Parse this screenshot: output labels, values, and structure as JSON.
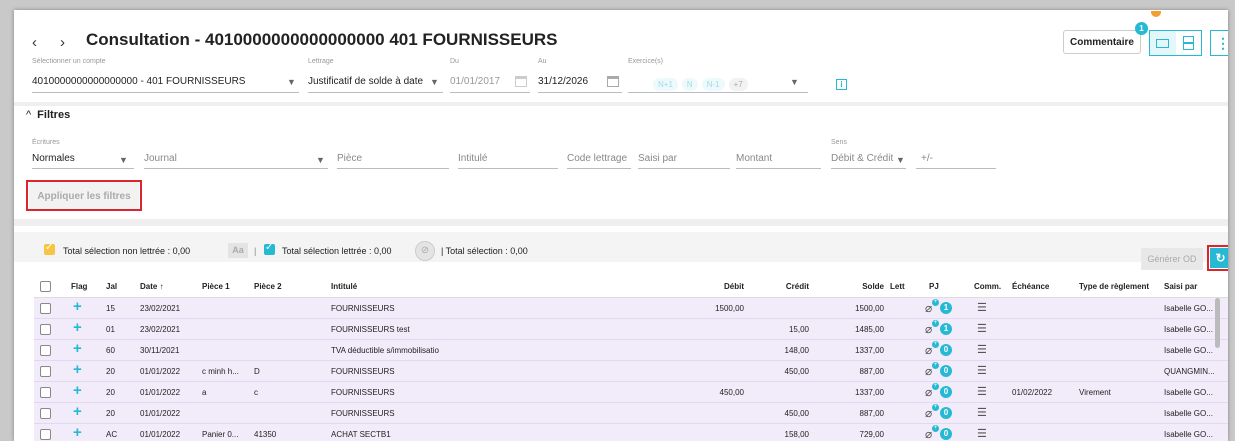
{
  "header": {
    "title": "Consultation - 4010000000000000000 401 FOURNISSEURS",
    "account_label": "Sélectionner un compte",
    "account_value": "4010000000000000000 - 401 FOURNISSEURS",
    "lettrage_label": "Lettrage",
    "lettrage_value": "Justificatif de solde à date",
    "du_label": "Du",
    "du_value": "01/01/2017",
    "au_label": "Au",
    "au_value": "31/12/2026",
    "exercice_label": "Exercice(s)",
    "exercice_chips": [
      "N+1",
      "N",
      "N-1",
      "+7"
    ],
    "comment_label": "Commentaire",
    "comment_badge": "1"
  },
  "filters": {
    "title": "Filtres",
    "ecritures_label": "Écritures",
    "ecritures_value": "Normales",
    "journal_placeholder": "Journal",
    "piece_placeholder": "Pièce",
    "intitule_placeholder": "Intitulé",
    "code_lettrage_placeholder": "Code lettrage",
    "saisi_par_placeholder": "Saisi par",
    "montant_placeholder": "Montant",
    "sens_label": "Sens",
    "sens_value": "Débit & Crédit",
    "plusminus_placeholder": "+/-",
    "apply_label": "Appliquer les filtres"
  },
  "toolbar": {
    "non_lettree": "Total sélection non lettrée : 0,00",
    "aa": "Aa",
    "lettree": "Total sélection lettrée : 0,00",
    "total": "| Total sélection : 0,00",
    "generer": "Générer OD"
  },
  "table": {
    "headers": [
      "Flag",
      "Jal",
      "Date ↑",
      "Pièce 1",
      "Pièce 2",
      "Intitulé",
      "Débit",
      "Crédit",
      "Solde",
      "Lett",
      "PJ",
      "Comm.",
      "Échéance",
      "Type de règlement",
      "Saisi par"
    ],
    "rows": [
      {
        "jal": "15",
        "date": "23/02/2021",
        "piece1": "",
        "piece2": "",
        "intitule": "FOURNISSEURS",
        "debit": "1500,00",
        "credit": "",
        "solde": "1500,00",
        "pj": "1",
        "echeance": "",
        "type": "",
        "saisi": "Isabelle GO..."
      },
      {
        "jal": "01",
        "date": "23/02/2021",
        "piece1": "",
        "piece2": "",
        "intitule": "FOURNISSEURS test",
        "debit": "",
        "credit": "15,00",
        "solde": "1485,00",
        "pj": "1",
        "echeance": "",
        "type": "",
        "saisi": "Isabelle GO..."
      },
      {
        "jal": "60",
        "date": "30/11/2021",
        "piece1": "",
        "piece2": "",
        "intitule": "TVA déductible s/immobilisatio",
        "debit": "",
        "credit": "148,00",
        "solde": "1337,00",
        "pj": "0",
        "echeance": "",
        "type": "",
        "saisi": "Isabelle GO..."
      },
      {
        "jal": "20",
        "date": "01/01/2022",
        "piece1": "c minh h...",
        "piece2": "D",
        "intitule": "FOURNISSEURS",
        "debit": "",
        "credit": "450,00",
        "solde": "887,00",
        "pj": "0",
        "echeance": "",
        "type": "",
        "saisi": "QUANGMIN..."
      },
      {
        "jal": "20",
        "date": "01/01/2022",
        "piece1": "a",
        "piece2": "c",
        "intitule": "FOURNISSEURS",
        "debit": "450,00",
        "credit": "",
        "solde": "1337,00",
        "pj": "0",
        "echeance": "01/02/2022",
        "type": "Virement",
        "saisi": "Isabelle GO..."
      },
      {
        "jal": "20",
        "date": "01/01/2022",
        "piece1": "",
        "piece2": "",
        "intitule": "FOURNISSEURS",
        "debit": "",
        "credit": "450,00",
        "solde": "887,00",
        "pj": "0",
        "echeance": "",
        "type": "",
        "saisi": "Isabelle GO..."
      },
      {
        "jal": "AC",
        "date": "01/01/2022",
        "piece1": "Panier 0...",
        "piece2": "41350",
        "intitule": "ACHAT SECTB1",
        "debit": "",
        "credit": "158,00",
        "solde": "729,00",
        "pj": "0",
        "echeance": "",
        "type": "",
        "saisi": "Isabelle GO..."
      }
    ]
  },
  "colors": {
    "accent": "#26b9d4",
    "highlight": "#d9262e",
    "row_bg": "#f2ecfa",
    "checkbox_yellow": "#f7c443"
  }
}
